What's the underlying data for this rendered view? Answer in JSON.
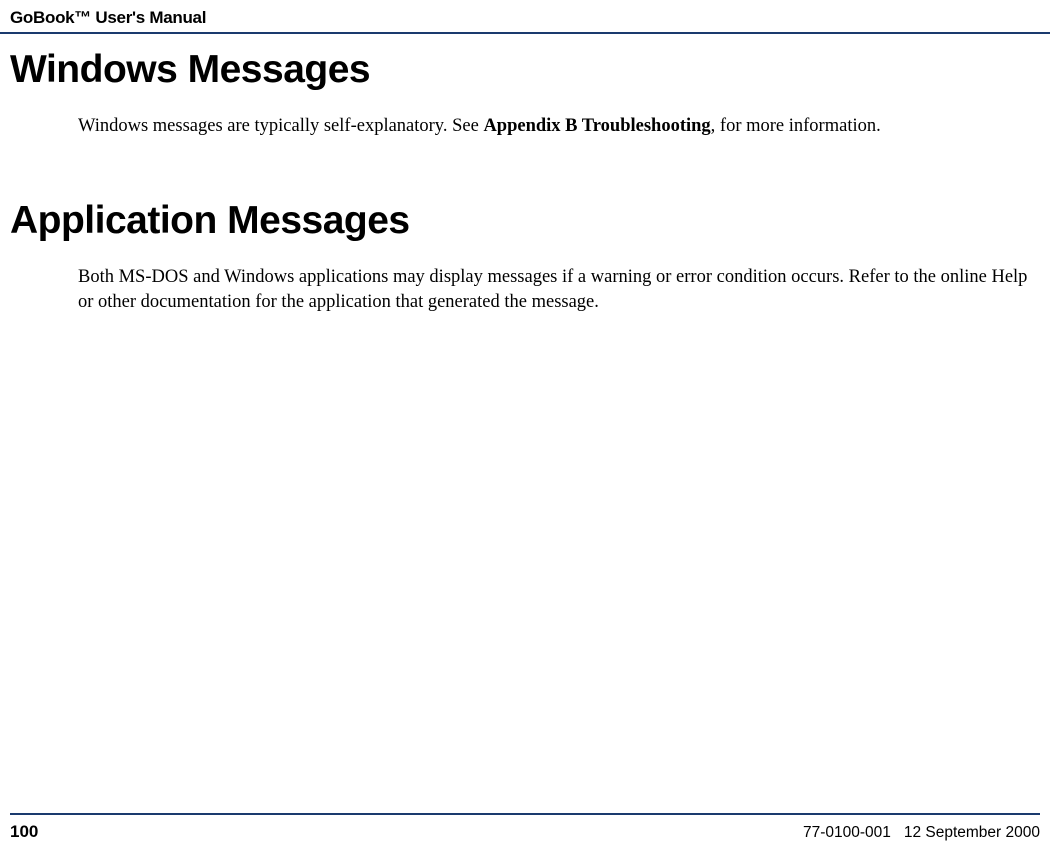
{
  "header": {
    "running_title": "GoBook™ User's Manual"
  },
  "sections": {
    "s1": {
      "heading": "Windows Messages",
      "body_prefix": "Windows messages are typically self-explanatory. See ",
      "body_bold": "Appendix B Troubleshooting",
      "body_suffix": ", for more information."
    },
    "s2": {
      "heading": "Application Messages",
      "body": "Both MS-DOS and Windows applications may display messages if a warning or error condition occurs. Refer to the online Help or other documentation for the application that generated the message."
    }
  },
  "footer": {
    "page_number": "100",
    "doc_id": "77-0100-001",
    "date": "12 September 2000"
  }
}
